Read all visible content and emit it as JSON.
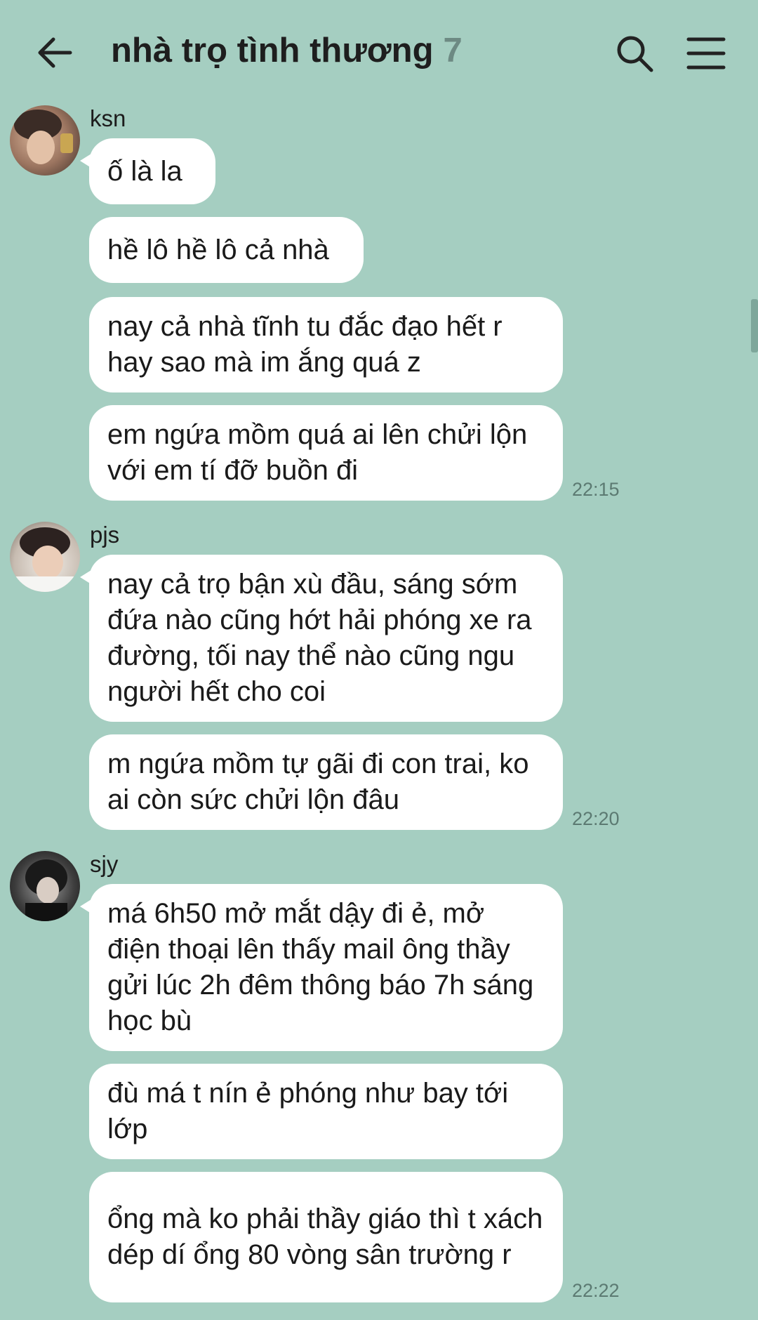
{
  "header": {
    "title": "nhà trọ tình thương",
    "member_count": "7",
    "back_icon": "arrow-left-icon",
    "search_icon": "search-icon",
    "menu_icon": "hamburger-menu-icon"
  },
  "colors": {
    "background": "#a5cec1",
    "bubble": "#ffffff",
    "timestamp": "#5c7a72"
  },
  "messages": [
    {
      "sender": "ksn",
      "avatar": "avatar-photo",
      "bubbles": [
        "ố là la",
        "hề lô hề lô cả nhà",
        "nay cả nhà tĩnh tu đắc đạo hết r hay sao mà im ắng quá z",
        "em ngứa mồm quá ai lên chửi lộn với em tí đỡ buồn đi"
      ],
      "time": "22:15"
    },
    {
      "sender": "pjs",
      "avatar": "avatar-photo",
      "bubbles": [
        "nay cả trọ bận xù đầu, sáng sớm đứa nào cũng hớt hải phóng xe ra đường, tối nay thể nào cũng ngu người hết cho coi",
        "m ngứa mồm tự gãi đi con trai, ko ai còn sức chửi lộn đâu"
      ],
      "time": "22:20"
    },
    {
      "sender": "sjy",
      "avatar": "avatar-photo",
      "bubbles": [
        "má 6h50 mở mắt dậy đi ẻ, mở điện thoại lên thấy mail ông thầy gửi lúc 2h đêm thông báo 7h sáng học bù",
        "đù má t nín ẻ phóng như bay tới lớp",
        "ổng mà ko phải thầy giáo thì t xách dép dí ổng 80 vòng sân trường r"
      ],
      "time": "22:22"
    }
  ]
}
